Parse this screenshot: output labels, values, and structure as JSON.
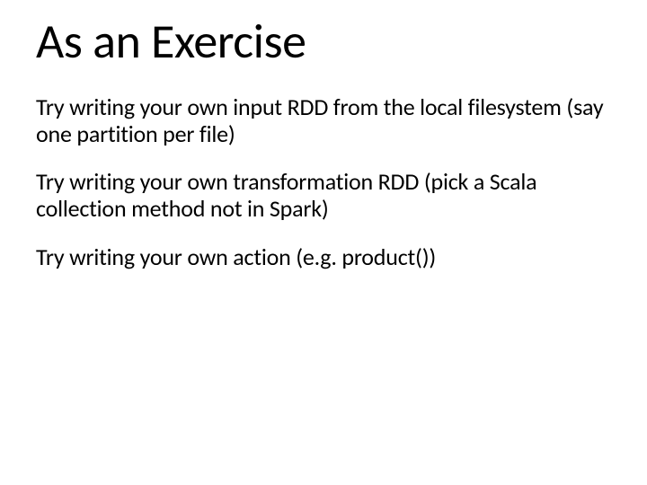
{
  "slide": {
    "title": "As an Exercise",
    "paragraphs": [
      "Try writing your own input RDD from the local filesystem (say one partition per file)",
      "Try writing your own transformation RDD (pick a Scala collection method not in Spark)",
      "Try writing your own action (e.g. product())"
    ]
  }
}
